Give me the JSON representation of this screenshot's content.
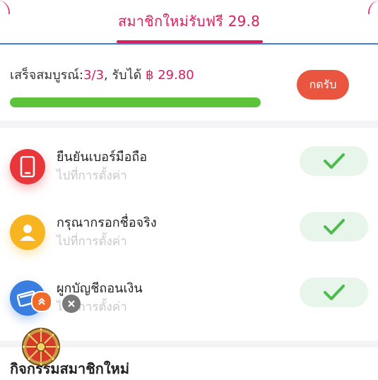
{
  "tab": {
    "title": "สมาชิกใหม่รับฟรี 29.8"
  },
  "progress": {
    "label_prefix": "เสร็จสมบูรณ์:",
    "count": "3/3",
    "label_mid": ", รับได้ ",
    "reward": "฿ 29.80",
    "fraction": 1.0,
    "claim_label": "กดรับ"
  },
  "tasks": [
    {
      "title": "ยืนยันเบอร์มือถือ",
      "subtitle": "ไปที่การตั้งค่า",
      "icon": "phone-icon",
      "color": "#e8373b",
      "done": true
    },
    {
      "title": "กรุณากรอกชื่อจริง",
      "subtitle": "ไปที่การตั้งค่า",
      "icon": "user-icon",
      "color": "#f8b522",
      "done": true
    },
    {
      "title": "ผูกบัญชีถอนเงิน",
      "subtitle": "ไปที่การตั้งค่า",
      "icon": "card-icon",
      "color": "#3a7ee0",
      "done": true
    }
  ],
  "bottom": {
    "title": "กิจกรรมสมาชิกใหม่"
  },
  "colors": {
    "accent": "#d81f5f",
    "progress": "#5cc33a",
    "button": "#e9553f",
    "check": "#4cbb4c"
  }
}
